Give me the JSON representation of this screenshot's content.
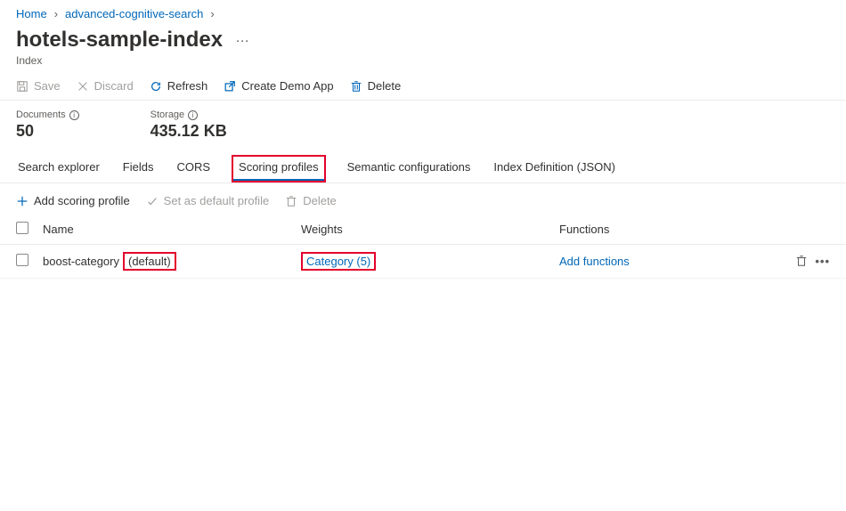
{
  "breadcrumb": {
    "home": "Home",
    "parent": "advanced-cognitive-search"
  },
  "page": {
    "title": "hotels-sample-index",
    "subtype": "Index"
  },
  "toolbar": {
    "save": "Save",
    "discard": "Discard",
    "refresh": "Refresh",
    "createDemo": "Create Demo App",
    "delete": "Delete"
  },
  "stats": {
    "docLabel": "Documents",
    "docVal": "50",
    "storLabel": "Storage",
    "storVal": "435.12 KB"
  },
  "tabs": {
    "searchExplorer": "Search explorer",
    "fields": "Fields",
    "cors": "CORS",
    "scoringProfiles": "Scoring profiles",
    "semantic": "Semantic configurations",
    "definition": "Index Definition (JSON)"
  },
  "sptoolbar": {
    "add": "Add scoring profile",
    "setDefault": "Set as default profile",
    "delete": "Delete"
  },
  "grid": {
    "headers": {
      "name": "Name",
      "weights": "Weights",
      "funcs": "Functions"
    },
    "row": {
      "name": "boost-category",
      "badge": "(default)",
      "weight": "Category (5)",
      "func": "Add functions"
    }
  }
}
